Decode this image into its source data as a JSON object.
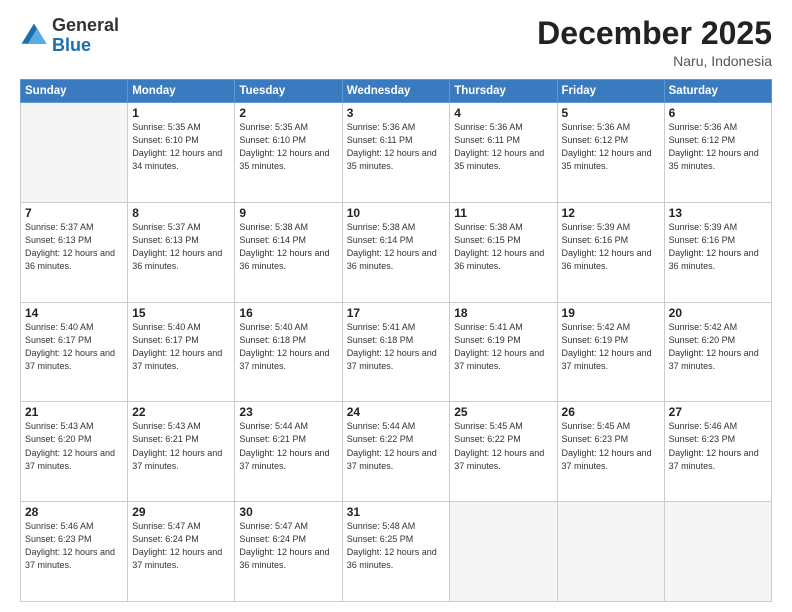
{
  "header": {
    "logo_general": "General",
    "logo_blue": "Blue",
    "month_title": "December 2025",
    "location": "Naru, Indonesia"
  },
  "weekdays": [
    "Sunday",
    "Monday",
    "Tuesday",
    "Wednesday",
    "Thursday",
    "Friday",
    "Saturday"
  ],
  "weeks": [
    [
      {
        "day": "",
        "sunrise": "",
        "sunset": "",
        "daylight": ""
      },
      {
        "day": "1",
        "sunrise": "Sunrise: 5:35 AM",
        "sunset": "Sunset: 6:10 PM",
        "daylight": "Daylight: 12 hours and 34 minutes."
      },
      {
        "day": "2",
        "sunrise": "Sunrise: 5:35 AM",
        "sunset": "Sunset: 6:10 PM",
        "daylight": "Daylight: 12 hours and 35 minutes."
      },
      {
        "day": "3",
        "sunrise": "Sunrise: 5:36 AM",
        "sunset": "Sunset: 6:11 PM",
        "daylight": "Daylight: 12 hours and 35 minutes."
      },
      {
        "day": "4",
        "sunrise": "Sunrise: 5:36 AM",
        "sunset": "Sunset: 6:11 PM",
        "daylight": "Daylight: 12 hours and 35 minutes."
      },
      {
        "day": "5",
        "sunrise": "Sunrise: 5:36 AM",
        "sunset": "Sunset: 6:12 PM",
        "daylight": "Daylight: 12 hours and 35 minutes."
      },
      {
        "day": "6",
        "sunrise": "Sunrise: 5:36 AM",
        "sunset": "Sunset: 6:12 PM",
        "daylight": "Daylight: 12 hours and 35 minutes."
      }
    ],
    [
      {
        "day": "7",
        "sunrise": "Sunrise: 5:37 AM",
        "sunset": "Sunset: 6:13 PM",
        "daylight": "Daylight: 12 hours and 36 minutes."
      },
      {
        "day": "8",
        "sunrise": "Sunrise: 5:37 AM",
        "sunset": "Sunset: 6:13 PM",
        "daylight": "Daylight: 12 hours and 36 minutes."
      },
      {
        "day": "9",
        "sunrise": "Sunrise: 5:38 AM",
        "sunset": "Sunset: 6:14 PM",
        "daylight": "Daylight: 12 hours and 36 minutes."
      },
      {
        "day": "10",
        "sunrise": "Sunrise: 5:38 AM",
        "sunset": "Sunset: 6:14 PM",
        "daylight": "Daylight: 12 hours and 36 minutes."
      },
      {
        "day": "11",
        "sunrise": "Sunrise: 5:38 AM",
        "sunset": "Sunset: 6:15 PM",
        "daylight": "Daylight: 12 hours and 36 minutes."
      },
      {
        "day": "12",
        "sunrise": "Sunrise: 5:39 AM",
        "sunset": "Sunset: 6:16 PM",
        "daylight": "Daylight: 12 hours and 36 minutes."
      },
      {
        "day": "13",
        "sunrise": "Sunrise: 5:39 AM",
        "sunset": "Sunset: 6:16 PM",
        "daylight": "Daylight: 12 hours and 36 minutes."
      }
    ],
    [
      {
        "day": "14",
        "sunrise": "Sunrise: 5:40 AM",
        "sunset": "Sunset: 6:17 PM",
        "daylight": "Daylight: 12 hours and 37 minutes."
      },
      {
        "day": "15",
        "sunrise": "Sunrise: 5:40 AM",
        "sunset": "Sunset: 6:17 PM",
        "daylight": "Daylight: 12 hours and 37 minutes."
      },
      {
        "day": "16",
        "sunrise": "Sunrise: 5:40 AM",
        "sunset": "Sunset: 6:18 PM",
        "daylight": "Daylight: 12 hours and 37 minutes."
      },
      {
        "day": "17",
        "sunrise": "Sunrise: 5:41 AM",
        "sunset": "Sunset: 6:18 PM",
        "daylight": "Daylight: 12 hours and 37 minutes."
      },
      {
        "day": "18",
        "sunrise": "Sunrise: 5:41 AM",
        "sunset": "Sunset: 6:19 PM",
        "daylight": "Daylight: 12 hours and 37 minutes."
      },
      {
        "day": "19",
        "sunrise": "Sunrise: 5:42 AM",
        "sunset": "Sunset: 6:19 PM",
        "daylight": "Daylight: 12 hours and 37 minutes."
      },
      {
        "day": "20",
        "sunrise": "Sunrise: 5:42 AM",
        "sunset": "Sunset: 6:20 PM",
        "daylight": "Daylight: 12 hours and 37 minutes."
      }
    ],
    [
      {
        "day": "21",
        "sunrise": "Sunrise: 5:43 AM",
        "sunset": "Sunset: 6:20 PM",
        "daylight": "Daylight: 12 hours and 37 minutes."
      },
      {
        "day": "22",
        "sunrise": "Sunrise: 5:43 AM",
        "sunset": "Sunset: 6:21 PM",
        "daylight": "Daylight: 12 hours and 37 minutes."
      },
      {
        "day": "23",
        "sunrise": "Sunrise: 5:44 AM",
        "sunset": "Sunset: 6:21 PM",
        "daylight": "Daylight: 12 hours and 37 minutes."
      },
      {
        "day": "24",
        "sunrise": "Sunrise: 5:44 AM",
        "sunset": "Sunset: 6:22 PM",
        "daylight": "Daylight: 12 hours and 37 minutes."
      },
      {
        "day": "25",
        "sunrise": "Sunrise: 5:45 AM",
        "sunset": "Sunset: 6:22 PM",
        "daylight": "Daylight: 12 hours and 37 minutes."
      },
      {
        "day": "26",
        "sunrise": "Sunrise: 5:45 AM",
        "sunset": "Sunset: 6:23 PM",
        "daylight": "Daylight: 12 hours and 37 minutes."
      },
      {
        "day": "27",
        "sunrise": "Sunrise: 5:46 AM",
        "sunset": "Sunset: 6:23 PM",
        "daylight": "Daylight: 12 hours and 37 minutes."
      }
    ],
    [
      {
        "day": "28",
        "sunrise": "Sunrise: 5:46 AM",
        "sunset": "Sunset: 6:23 PM",
        "daylight": "Daylight: 12 hours and 37 minutes."
      },
      {
        "day": "29",
        "sunrise": "Sunrise: 5:47 AM",
        "sunset": "Sunset: 6:24 PM",
        "daylight": "Daylight: 12 hours and 37 minutes."
      },
      {
        "day": "30",
        "sunrise": "Sunrise: 5:47 AM",
        "sunset": "Sunset: 6:24 PM",
        "daylight": "Daylight: 12 hours and 36 minutes."
      },
      {
        "day": "31",
        "sunrise": "Sunrise: 5:48 AM",
        "sunset": "Sunset: 6:25 PM",
        "daylight": "Daylight: 12 hours and 36 minutes."
      },
      {
        "day": "",
        "sunrise": "",
        "sunset": "",
        "daylight": ""
      },
      {
        "day": "",
        "sunrise": "",
        "sunset": "",
        "daylight": ""
      },
      {
        "day": "",
        "sunrise": "",
        "sunset": "",
        "daylight": ""
      }
    ]
  ]
}
